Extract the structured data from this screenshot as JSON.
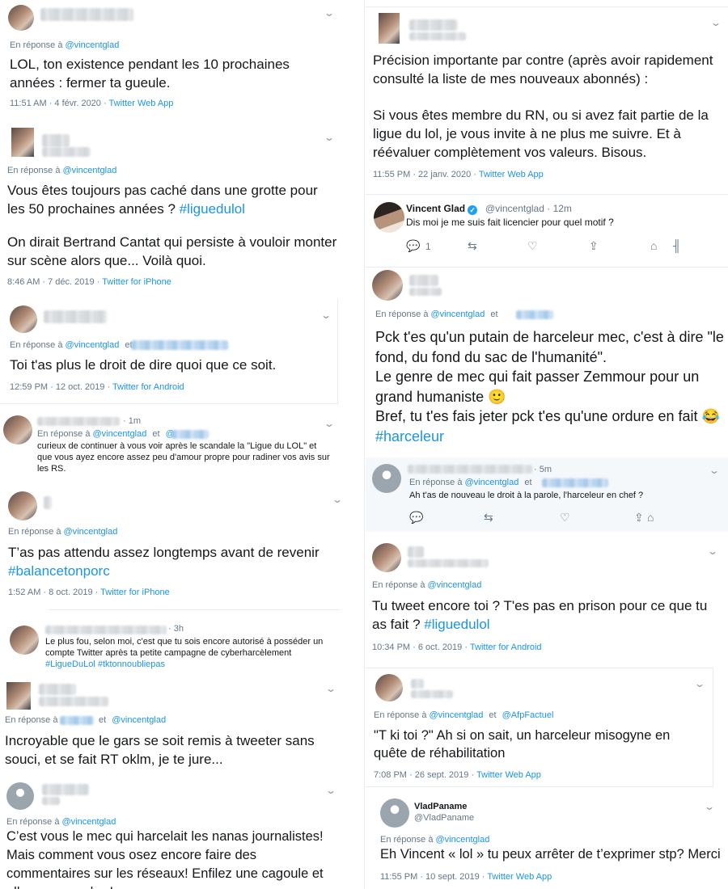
{
  "common": {
    "reply_label": "En réponse à",
    "vincent": "@vincentglad",
    "et": "et",
    "dot": "·"
  },
  "left": {
    "t1": {
      "text": "LOL, ton existence pendant les 10 prochaines années : fermer ta gueule.",
      "time": "11:51 AM · 4 févr. 2020",
      "source": "Twitter Web App"
    },
    "t2": {
      "text_a": "Vous êtes toujours pas caché dans une grotte pour les 50 prochaines années ? ",
      "hashtag": "#liguedulol",
      "text_b": "On dirait Bertrand Cantat qui persiste à vouloir monter sur scène alors que... Voilà quoi.",
      "time": "8:46 AM · 7 déc. 2019",
      "source": "Twitter for iPhone"
    },
    "t3": {
      "text": "Toi t'as plus le droit de dire quoi que ce soit.",
      "time": "12:59 PM · 12 oct. 2019",
      "source": "Twitter for Android"
    },
    "t4": {
      "age": "1m",
      "other_handle_prefix": "@",
      "text": "curieux de continuer à vous voir après le scandale la \"Ligue du LOL\" et que vous ayez encore assez peu d'amour propre pour radiner vos avis sur les RS."
    },
    "t5": {
      "text": "T’as pas attendu assez longtemps avant de revenir ",
      "hashtag": "#balancetonporc",
      "time": "1:52 AM · 8 oct. 2019",
      "source": "Twitter for iPhone"
    },
    "t6": {
      "age": "3h",
      "text": "Le plus fou, selon moi, c'est que tu sois encore autorisé à posséder un compte Twitter après ta petite campagne de cyberharcèlement ",
      "hashtags": "#LigueDuLol #tktonnoubliepas"
    },
    "t7": {
      "text": "Incroyable que le gars se soit remis à tweeter sans souci, et se fait RT oklm, je te jure..."
    },
    "t8": {
      "text": "C’est vous le mec qui harcelait les nanas journalistes! Mais comment vous osez encore faire des commentaires sur les réseaux! Enfilez une cagoule et allez vous cacher!"
    }
  },
  "right": {
    "t1": {
      "text_a": "Précision importante par contre (après avoir rapidement consulté la liste de mes nouveaux abonnés) :",
      "text_b": "Si vous êtes membre du RN, ou si avez fait partie de la ligue du lol, je vous invite à ne plus me suivre. Et à réévaluer complètement vos valeurs. Bisous.",
      "time": "11:55 PM · 22 janv. 2020",
      "source": "Twitter Web App"
    },
    "t2": {
      "name": "Vincent Glad",
      "handle": "@vincentglad",
      "age": "12m",
      "text": "Dis moi je me suis fait licencier pour quel motif ?",
      "reply_count": "1"
    },
    "t3": {
      "line1": "Pck t'es qu'un putain de harceleur mec, c'est à dire \"le fond, du fond du sac de l'humanité\".",
      "line2": "Le genre de mec qui fait passer Zemmour pour un grand humaniste ",
      "emoji1": "🙂",
      "line3": "Bref, tu t'es fais jeter pck t'es qu'une ordure en fait ",
      "emoji2": "😂",
      "hashtag": "#harceleur"
    },
    "t4": {
      "age": "5m",
      "text": "Ah t'as de nouveau le droit à la parole, l'harceleur en chef ?"
    },
    "t5": {
      "text": "Tu tweet encore toi ? T'es pas en prison pour ce que tu as fait ? ",
      "hashtag": "#liguedulol",
      "time": "10:34 PM · 6 oct. 2019",
      "source": "Twitter for Android"
    },
    "t6": {
      "other": "@AfpFactuel",
      "text": "\"T ki toi ?\" Ah si on sait, un harceleur misogyne en quête de réhabilitation",
      "time": "7:08 PM · 26 sept. 2019",
      "source": "Twitter Web App"
    },
    "t7": {
      "name": "VladPaname",
      "handle": "@VladPaname",
      "text": "Eh Vincent « lol » tu peux arrêter de t’exprimer stp? Merci",
      "time": "11:55 PM · 10 sept. 2019",
      "source": "Twitter Web App"
    }
  },
  "icons": [
    "chevron-down-icon",
    "reply-icon",
    "retweet-icon",
    "like-icon",
    "share-icon",
    "verified-icon",
    "analytics-icon"
  ],
  "colors": {
    "link": "#1b95e0",
    "text": "#14171a",
    "muted": "#657786",
    "verified": "#1da1f2"
  }
}
